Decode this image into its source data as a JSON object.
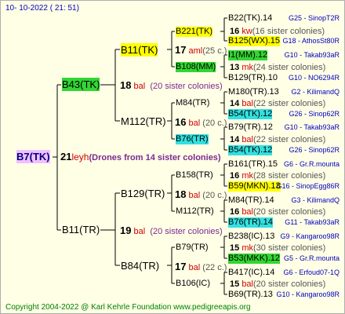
{
  "header": {
    "date": "10- 10-2022 ( 21: 51)"
  },
  "root": {
    "name": "B7(TK)",
    "year": "21",
    "breeder": "leyh",
    "note": "(Drones from 14 sister colonies)"
  },
  "gen1": [
    {
      "name": "B43(TK)",
      "year": "18",
      "breeder": "bal",
      "sisters": "(20 sister colonies)"
    },
    {
      "name": "B11(TR)",
      "year": "19",
      "breeder": "bal",
      "sisters": "(20 sister colonies)"
    }
  ],
  "gen2": [
    {
      "name": "B11(TK)",
      "year": "17",
      "breeder": "aml",
      "sisters": "(25 c.)"
    },
    {
      "name": "M112(TR)",
      "year": "16",
      "breeder": "bal",
      "sisters": "(20 c.)"
    },
    {
      "name": "B129(TR)",
      "year": "18",
      "breeder": "bal",
      "sisters": "(20 c.)"
    },
    {
      "name": "B84(TR)",
      "year": "17",
      "breeder": "bal",
      "sisters": "(22 c.)"
    }
  ],
  "gen3": [
    {
      "name": "B221(TK)",
      "year": "16",
      "breeder": "kw",
      "sisters": "(16 sister colonies)"
    },
    {
      "name": "B108(MM)",
      "year": "13",
      "breeder": "mk",
      "sisters": "(24 sister colonies)"
    },
    {
      "name": "M84(TR)",
      "year": "14",
      "breeder": "bal",
      "sisters": "(22 sister colonies)"
    },
    {
      "name": "B76(TR)",
      "year": "14",
      "breeder": "bal",
      "sisters": "(22 sister colonies)"
    },
    {
      "name": "B158(TR)",
      "year": "16",
      "breeder": "mk",
      "sisters": "(28 sister colonies)"
    },
    {
      "name": "M112(TR)",
      "year": "16",
      "breeder": "bal",
      "sisters": "(20 sister colonies)"
    },
    {
      "name": "B79(TR)",
      "year": "15",
      "breeder": "mk",
      "sisters": "(30 sister colonies)"
    },
    {
      "name": "B106(IC)",
      "year": "15",
      "breeder": "bal",
      "sisters": "(20 sister colonies)"
    }
  ],
  "gen4": [
    {
      "name": "B22(TK).14",
      "ped": "G25 - SinopT2R"
    },
    {
      "name": "B125(WX).15",
      "ped": "G18 - AthosSt80R"
    },
    {
      "name": "I1(MM).12",
      "ped": "G10 - Takab93aR"
    },
    {
      "name": "B129(TR).10",
      "ped": "G10 - NO6294R"
    },
    {
      "name": "M180(TR).13",
      "ped": "G2 - KilimandQ"
    },
    {
      "name": "B54(TK).12",
      "ped": "G26 - Sinop62R"
    },
    {
      "name": "B79(TR).12",
      "ped": "G10 - Takab93aR"
    },
    {
      "name": "B54(TK).12",
      "ped": "G26 - Sinop62R"
    },
    {
      "name": "B161(TR).15",
      "ped": "G6 - Gr.R.mounta"
    },
    {
      "name": "B59(MKN).13",
      "ped": "G16 - SinopEgg86R"
    },
    {
      "name": "M84(TR).14",
      "ped": "G3 - KilimandQ"
    },
    {
      "name": "B76(TR).14",
      "ped": "G11 - Takab93aR"
    },
    {
      "name": "B238(IC).13",
      "ped": "G9 - Kangaroo98R"
    },
    {
      "name": "B53(MKK).12",
      "ped": "G5 - Gr.R.mounta"
    },
    {
      "name": "B417(IC).14",
      "ped": "G6 - Erfoud07-1Q"
    },
    {
      "name": "B69(TR).13",
      "ped": "G10 - Kangaroo98R"
    }
  ],
  "footer": {
    "text": "Copyright 2004-2022 @ Karl Kehrle Foundation    www.pedigreeapis.org"
  }
}
